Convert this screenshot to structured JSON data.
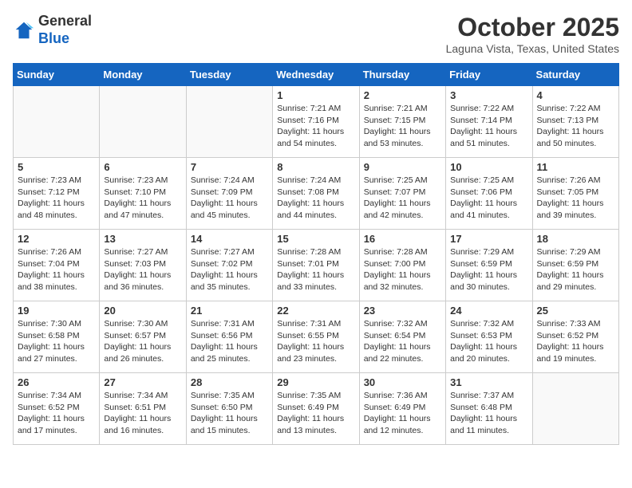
{
  "header": {
    "logo_general": "General",
    "logo_blue": "Blue",
    "month_title": "October 2025",
    "location": "Laguna Vista, Texas, United States"
  },
  "weekdays": [
    "Sunday",
    "Monday",
    "Tuesday",
    "Wednesday",
    "Thursday",
    "Friday",
    "Saturday"
  ],
  "weeks": [
    [
      {
        "day": "",
        "info": ""
      },
      {
        "day": "",
        "info": ""
      },
      {
        "day": "",
        "info": ""
      },
      {
        "day": "1",
        "info": "Sunrise: 7:21 AM\nSunset: 7:16 PM\nDaylight: 11 hours\nand 54 minutes."
      },
      {
        "day": "2",
        "info": "Sunrise: 7:21 AM\nSunset: 7:15 PM\nDaylight: 11 hours\nand 53 minutes."
      },
      {
        "day": "3",
        "info": "Sunrise: 7:22 AM\nSunset: 7:14 PM\nDaylight: 11 hours\nand 51 minutes."
      },
      {
        "day": "4",
        "info": "Sunrise: 7:22 AM\nSunset: 7:13 PM\nDaylight: 11 hours\nand 50 minutes."
      }
    ],
    [
      {
        "day": "5",
        "info": "Sunrise: 7:23 AM\nSunset: 7:12 PM\nDaylight: 11 hours\nand 48 minutes."
      },
      {
        "day": "6",
        "info": "Sunrise: 7:23 AM\nSunset: 7:10 PM\nDaylight: 11 hours\nand 47 minutes."
      },
      {
        "day": "7",
        "info": "Sunrise: 7:24 AM\nSunset: 7:09 PM\nDaylight: 11 hours\nand 45 minutes."
      },
      {
        "day": "8",
        "info": "Sunrise: 7:24 AM\nSunset: 7:08 PM\nDaylight: 11 hours\nand 44 minutes."
      },
      {
        "day": "9",
        "info": "Sunrise: 7:25 AM\nSunset: 7:07 PM\nDaylight: 11 hours\nand 42 minutes."
      },
      {
        "day": "10",
        "info": "Sunrise: 7:25 AM\nSunset: 7:06 PM\nDaylight: 11 hours\nand 41 minutes."
      },
      {
        "day": "11",
        "info": "Sunrise: 7:26 AM\nSunset: 7:05 PM\nDaylight: 11 hours\nand 39 minutes."
      }
    ],
    [
      {
        "day": "12",
        "info": "Sunrise: 7:26 AM\nSunset: 7:04 PM\nDaylight: 11 hours\nand 38 minutes."
      },
      {
        "day": "13",
        "info": "Sunrise: 7:27 AM\nSunset: 7:03 PM\nDaylight: 11 hours\nand 36 minutes."
      },
      {
        "day": "14",
        "info": "Sunrise: 7:27 AM\nSunset: 7:02 PM\nDaylight: 11 hours\nand 35 minutes."
      },
      {
        "day": "15",
        "info": "Sunrise: 7:28 AM\nSunset: 7:01 PM\nDaylight: 11 hours\nand 33 minutes."
      },
      {
        "day": "16",
        "info": "Sunrise: 7:28 AM\nSunset: 7:00 PM\nDaylight: 11 hours\nand 32 minutes."
      },
      {
        "day": "17",
        "info": "Sunrise: 7:29 AM\nSunset: 6:59 PM\nDaylight: 11 hours\nand 30 minutes."
      },
      {
        "day": "18",
        "info": "Sunrise: 7:29 AM\nSunset: 6:59 PM\nDaylight: 11 hours\nand 29 minutes."
      }
    ],
    [
      {
        "day": "19",
        "info": "Sunrise: 7:30 AM\nSunset: 6:58 PM\nDaylight: 11 hours\nand 27 minutes."
      },
      {
        "day": "20",
        "info": "Sunrise: 7:30 AM\nSunset: 6:57 PM\nDaylight: 11 hours\nand 26 minutes."
      },
      {
        "day": "21",
        "info": "Sunrise: 7:31 AM\nSunset: 6:56 PM\nDaylight: 11 hours\nand 25 minutes."
      },
      {
        "day": "22",
        "info": "Sunrise: 7:31 AM\nSunset: 6:55 PM\nDaylight: 11 hours\nand 23 minutes."
      },
      {
        "day": "23",
        "info": "Sunrise: 7:32 AM\nSunset: 6:54 PM\nDaylight: 11 hours\nand 22 minutes."
      },
      {
        "day": "24",
        "info": "Sunrise: 7:32 AM\nSunset: 6:53 PM\nDaylight: 11 hours\nand 20 minutes."
      },
      {
        "day": "25",
        "info": "Sunrise: 7:33 AM\nSunset: 6:52 PM\nDaylight: 11 hours\nand 19 minutes."
      }
    ],
    [
      {
        "day": "26",
        "info": "Sunrise: 7:34 AM\nSunset: 6:52 PM\nDaylight: 11 hours\nand 17 minutes."
      },
      {
        "day": "27",
        "info": "Sunrise: 7:34 AM\nSunset: 6:51 PM\nDaylight: 11 hours\nand 16 minutes."
      },
      {
        "day": "28",
        "info": "Sunrise: 7:35 AM\nSunset: 6:50 PM\nDaylight: 11 hours\nand 15 minutes."
      },
      {
        "day": "29",
        "info": "Sunrise: 7:35 AM\nSunset: 6:49 PM\nDaylight: 11 hours\nand 13 minutes."
      },
      {
        "day": "30",
        "info": "Sunrise: 7:36 AM\nSunset: 6:49 PM\nDaylight: 11 hours\nand 12 minutes."
      },
      {
        "day": "31",
        "info": "Sunrise: 7:37 AM\nSunset: 6:48 PM\nDaylight: 11 hours\nand 11 minutes."
      },
      {
        "day": "",
        "info": ""
      }
    ]
  ]
}
